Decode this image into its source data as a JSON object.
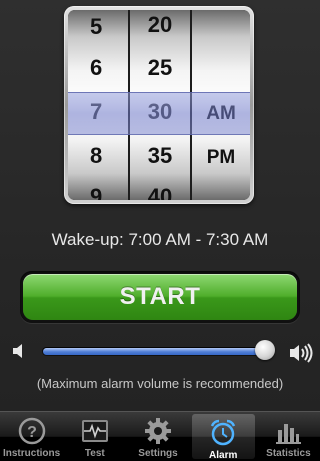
{
  "picker": {
    "hours": [
      "5",
      "6",
      "7",
      "8",
      "9"
    ],
    "minutes": [
      "20",
      "25",
      "30",
      "35",
      "40"
    ],
    "periods": [
      "AM",
      "PM"
    ]
  },
  "wakeup_text": "Wake-up: 7:00 AM - 7:30 AM",
  "start_label": "START",
  "volume": {
    "level": 0.97,
    "hint": "(Maximum alarm volume is recommended)"
  },
  "tabs": [
    {
      "label": "Instructions",
      "icon": "question-circle-icon",
      "active": false
    },
    {
      "label": "Test",
      "icon": "pulse-monitor-icon",
      "active": false
    },
    {
      "label": "Settings",
      "icon": "gear-icon",
      "active": false
    },
    {
      "label": "Alarm",
      "icon": "alarm-clock-icon",
      "active": true
    },
    {
      "label": "Statistics",
      "icon": "bar-chart-icon",
      "active": false
    }
  ],
  "colors": {
    "start_green": "#4fae2b",
    "selection_blue": "#6e78c8",
    "slider_blue": "#4f7ed6"
  }
}
